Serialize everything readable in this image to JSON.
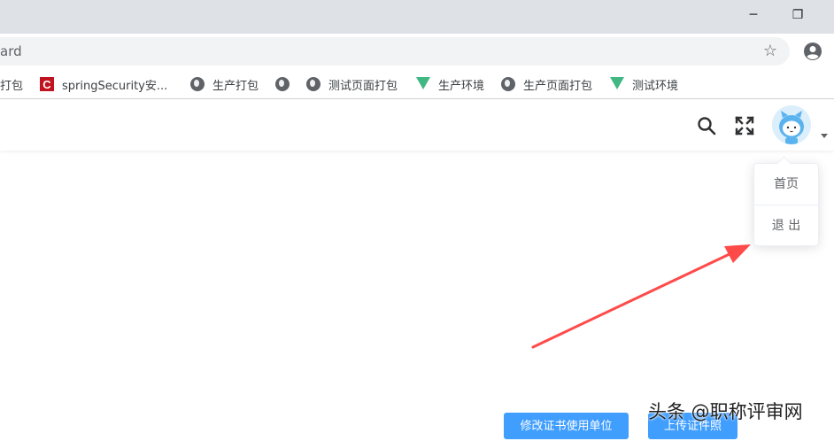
{
  "window": {
    "minimize_glyph": "─",
    "restore_glyph": "❐"
  },
  "omnibox": {
    "url_fragment": "ard",
    "star_icon": "star-icon",
    "profile_icon": "account-circle-icon"
  },
  "bookmarks": [
    {
      "label": "打包",
      "icon": "none"
    },
    {
      "label": "springSecurity安...",
      "icon": "red-c-icon"
    },
    {
      "label": "生产打包",
      "icon": "globe-icon"
    },
    {
      "label": "",
      "icon": "globe-icon"
    },
    {
      "label": "测试页面打包",
      "icon": "globe-icon"
    },
    {
      "label": "生产环境",
      "icon": "vue-icon"
    },
    {
      "label": "生产页面打包",
      "icon": "globe-icon"
    },
    {
      "label": "测试环境",
      "icon": "vue-icon"
    }
  ],
  "header": {
    "search_icon": "search-icon",
    "fullscreen_icon": "fullscreen-icon",
    "avatar": "user-avatar"
  },
  "dropdown": {
    "items": [
      {
        "label": "首页"
      },
      {
        "label": "退 出"
      }
    ]
  },
  "buttons": {
    "modify_cert_unit": "修改证书使用单位",
    "upload_cert_photo": "上传证件照"
  },
  "watermark": "头条 @职称评审网",
  "colors": {
    "primary": "#409eff",
    "arrow": "#ff4a4a",
    "titlebar": "#dee1e6"
  }
}
